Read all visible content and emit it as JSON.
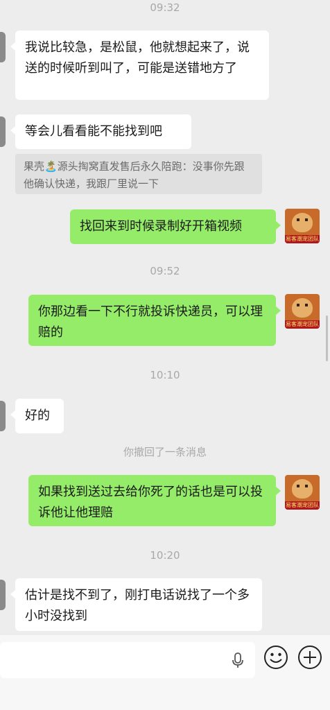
{
  "timestamps": [
    "09:32",
    "09:52",
    "10:10",
    "10:20"
  ],
  "messages": {
    "m1": "我说比较急，是松鼠，他就想起来了，说送的时候听到叫了，可能是送错地方了",
    "m2": "等会儿看看能不能找到吧",
    "quote": "果壳🏝️源头掏窝直发售后永久陪跑：没事你先跟他确认快递，我跟厂里说一下",
    "m3": "找回来到时候录制好开箱视频",
    "m4": "你那边看一下不行就投诉快递员，可以理赔的",
    "m5": "好的",
    "m6": "如果找到送过去给你死了的话也是可以投诉他让他理赔",
    "m7": "估计是找不到了，刚打电话说找了一个多小时没找到"
  },
  "recall_notice": "你撤回了一条消息",
  "avatar_band_text": "易客潮宠团队",
  "icons": {
    "mic": "microphone-icon",
    "emoji": "emoji-icon",
    "plus": "plus-circle-icon"
  },
  "colors": {
    "self_bubble": "#95ec69",
    "other_bubble": "#ffffff",
    "background": "#ededed"
  }
}
